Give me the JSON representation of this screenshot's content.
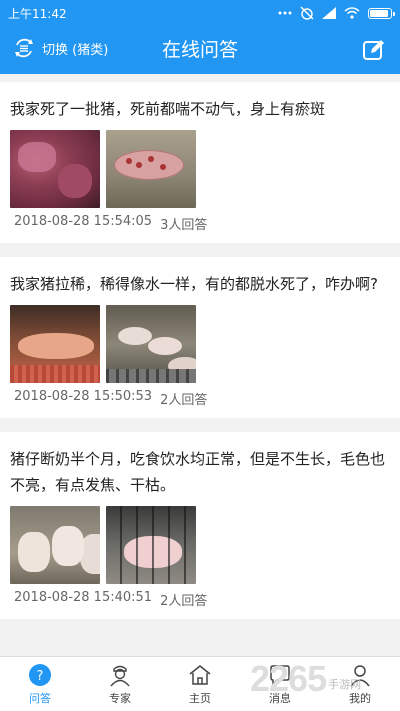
{
  "status_bar": {
    "time": "上午11:42"
  },
  "app_bar": {
    "switch_label": "切换 (猪类)",
    "title": "在线问答"
  },
  "questions": [
    {
      "title": "我家死了一批猪，死前都喘不动气，身上有瘀斑",
      "timestamp": "2018-08-28 15:54:05",
      "answers": "3人回答"
    },
    {
      "title": "我家猪拉稀，稀得像水一样，有的都脱水死了，咋办啊?",
      "timestamp": "2018-08-28 15:50:53",
      "answers": "2人回答"
    },
    {
      "title": "猪仔断奶半个月，吃食饮水均正常，但是不生长，毛色也不亮，有点发焦、干枯。",
      "timestamp": "2018-08-28 15:40:51",
      "answers": "2人回答"
    }
  ],
  "tabs": [
    {
      "label": "问答",
      "icon": "qa-icon",
      "active": true
    },
    {
      "label": "专家",
      "icon": "expert-icon",
      "active": false
    },
    {
      "label": "主页",
      "icon": "home-icon",
      "active": false
    },
    {
      "label": "消息",
      "icon": "message-icon",
      "active": false
    },
    {
      "label": "我的",
      "icon": "profile-icon",
      "active": false
    }
  ],
  "watermark": {
    "brand": "2265",
    "sub": "手游网"
  },
  "colors": {
    "accent": "#2196f3",
    "background": "#f2f2f2"
  }
}
